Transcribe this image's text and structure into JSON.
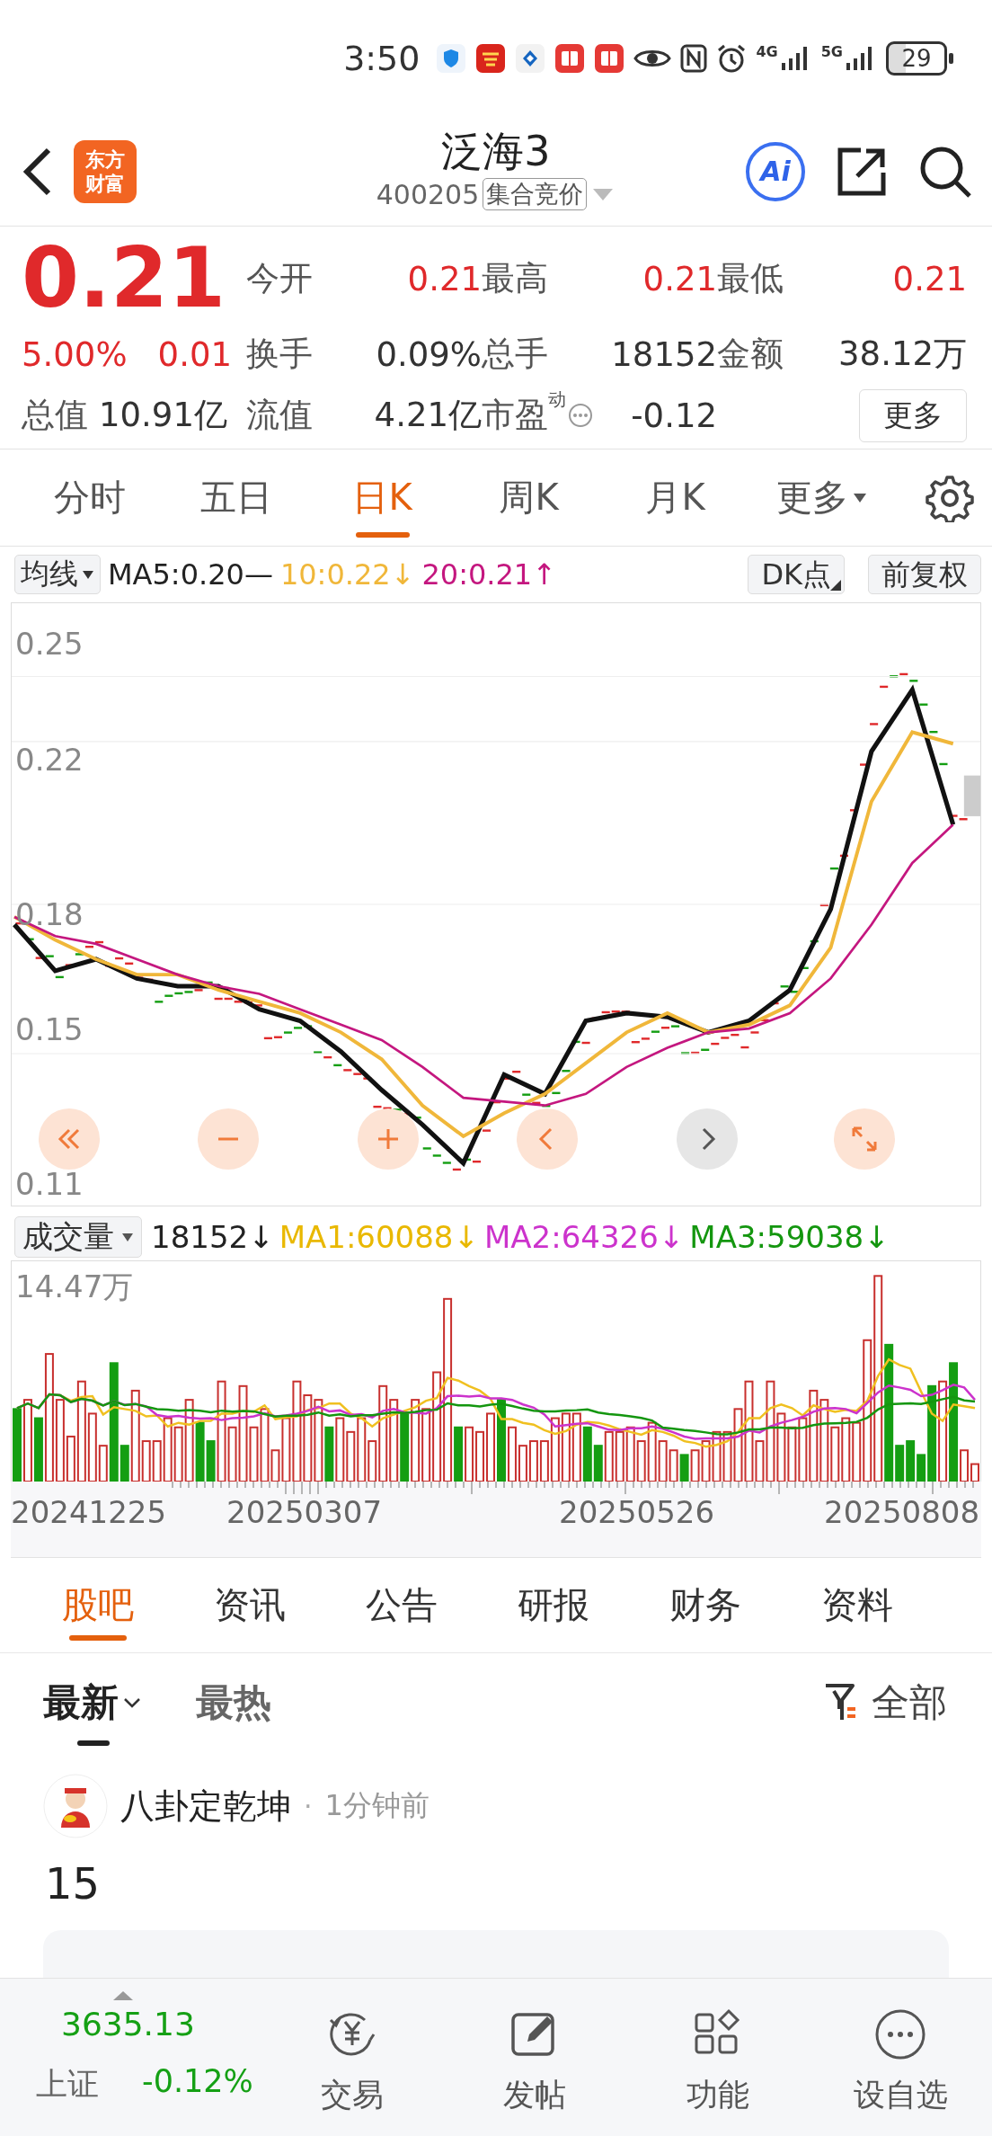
{
  "status_bar": {
    "time": "3:50",
    "network_1": "4G",
    "network_2": "5G",
    "battery": "29"
  },
  "header": {
    "logo": "东方财富",
    "title": "泛海3",
    "code": "400205",
    "badge": "集合竞价",
    "ai_label": "Ai"
  },
  "quote": {
    "price": "0.21",
    "change_pct": "5.00%",
    "change": "0.01",
    "total_value": {
      "label": "总值",
      "value": "10.91亿"
    },
    "stats": [
      {
        "label": "今开",
        "value": "0.21",
        "rising": true,
        "has_info": false
      },
      {
        "label": "最高",
        "value": "0.21",
        "rising": true,
        "has_info": false
      },
      {
        "label": "最低",
        "value": "0.21",
        "rising": true,
        "has_info": false
      },
      {
        "label": "换手",
        "value": "0.09%",
        "rising": false,
        "has_info": false
      },
      {
        "label": "总手",
        "value": "18152",
        "rising": false,
        "has_info": false
      },
      {
        "label": "金额",
        "value": "38.12万",
        "rising": false,
        "has_info": false
      },
      {
        "label": "流值",
        "value": "4.21亿",
        "rising": false,
        "has_info": false
      },
      {
        "label": "市盈$^{动}$",
        "value": "-0.12",
        "rising": false,
        "has_info": true
      }
    ],
    "more_button": "更多"
  },
  "chart_tabs": [
    {
      "label": "分时",
      "selected": false,
      "kind": "plain"
    },
    {
      "label": "五日",
      "selected": false,
      "kind": "plain"
    },
    {
      "label": "日K",
      "selected": true,
      "kind": "plain"
    },
    {
      "label": "周K",
      "selected": false,
      "kind": "plain"
    },
    {
      "label": "月K",
      "selected": false,
      "kind": "plain"
    },
    {
      "label": "更多",
      "selected": false,
      "kind": "dropdown"
    }
  ],
  "ma_legend": {
    "selector": "均线",
    "items": [
      {
        "text": "MA5:0.20—",
        "color": "#222222"
      },
      {
        "text": "10:0.22↓",
        "color": "#f0b73a"
      },
      {
        "text": "20:0.21↑",
        "color": "#c4177f"
      }
    ],
    "dk_button": "DK点",
    "adjust_button": "前复权"
  },
  "price_chart": {
    "chart_data": {
      "type": "line",
      "ylim": [
        0.104,
        0.2605
      ],
      "yticks": [
        0.25,
        0.22,
        0.18,
        0.15,
        0.11
      ],
      "series": [
        {
          "color": "#111111",
          "values": [
            0.177,
            0.165,
            0.168,
            0.163,
            0.161,
            0.161,
            0.155,
            0.152,
            0.144,
            0.134,
            0.125,
            0.115,
            0.138,
            0.133,
            0.152,
            0.154,
            0.153,
            0.149,
            0.152,
            0.16,
            0.181,
            0.222,
            0.238,
            0.203
          ]
        },
        {
          "color": "#f0b73a",
          "values": [
            0.179,
            0.173,
            0.168,
            0.164,
            0.164,
            0.16,
            0.157,
            0.154,
            0.149,
            0.142,
            0.13,
            0.122,
            0.128,
            0.133,
            0.141,
            0.149,
            0.154,
            0.149,
            0.151,
            0.156,
            0.171,
            0.209,
            0.227,
            0.224
          ]
        },
        {
          "color": "#c4177f",
          "values": [
            0.179,
            0.174,
            0.172,
            0.168,
            0.164,
            0.161,
            0.159,
            0.155,
            0.151,
            0.147,
            0.14,
            0.132,
            0.131,
            0.13,
            0.133,
            0.14,
            0.145,
            0.149,
            0.15,
            0.154,
            0.163,
            0.177,
            0.193,
            0.203
          ]
        }
      ]
    }
  },
  "volume": {
    "selector": "成交量",
    "items": [
      {
        "text": "18152↓",
        "color": "#222222"
      },
      {
        "text": "MA1:60088↓",
        "color": "#e9b800"
      },
      {
        "text": "MA2:64326↓",
        "color": "#cc33cc"
      },
      {
        "text": "MA3:59038↓",
        "color": "#14960f"
      }
    ],
    "max_label": "14.47万",
    "dates": [
      "20241225",
      "20250307",
      "20250526",
      "20250808"
    ]
  },
  "news_tabs": [
    {
      "label": "股吧",
      "selected": true
    },
    {
      "label": "资讯",
      "selected": false
    },
    {
      "label": "公告",
      "selected": false
    },
    {
      "label": "研报",
      "selected": false
    },
    {
      "label": "财务",
      "selected": false
    },
    {
      "label": "资料",
      "selected": false
    }
  ],
  "sort_tabs": [
    {
      "label": "最新",
      "selected": true
    },
    {
      "label": "最热",
      "selected": false
    }
  ],
  "filter": "全部",
  "post": {
    "author": "八卦定乾坤",
    "separator": "·",
    "time": "1分钟前",
    "body": "15"
  },
  "bottom_nav": {
    "index": {
      "name": "上证",
      "value": "3635.13",
      "change": "-0.12%"
    },
    "items": [
      {
        "label": "交易",
        "kind": "trade"
      },
      {
        "label": "发帖",
        "kind": "post"
      },
      {
        "label": "功能",
        "kind": "apps"
      },
      {
        "label": "设自选",
        "kind": "more"
      }
    ]
  }
}
